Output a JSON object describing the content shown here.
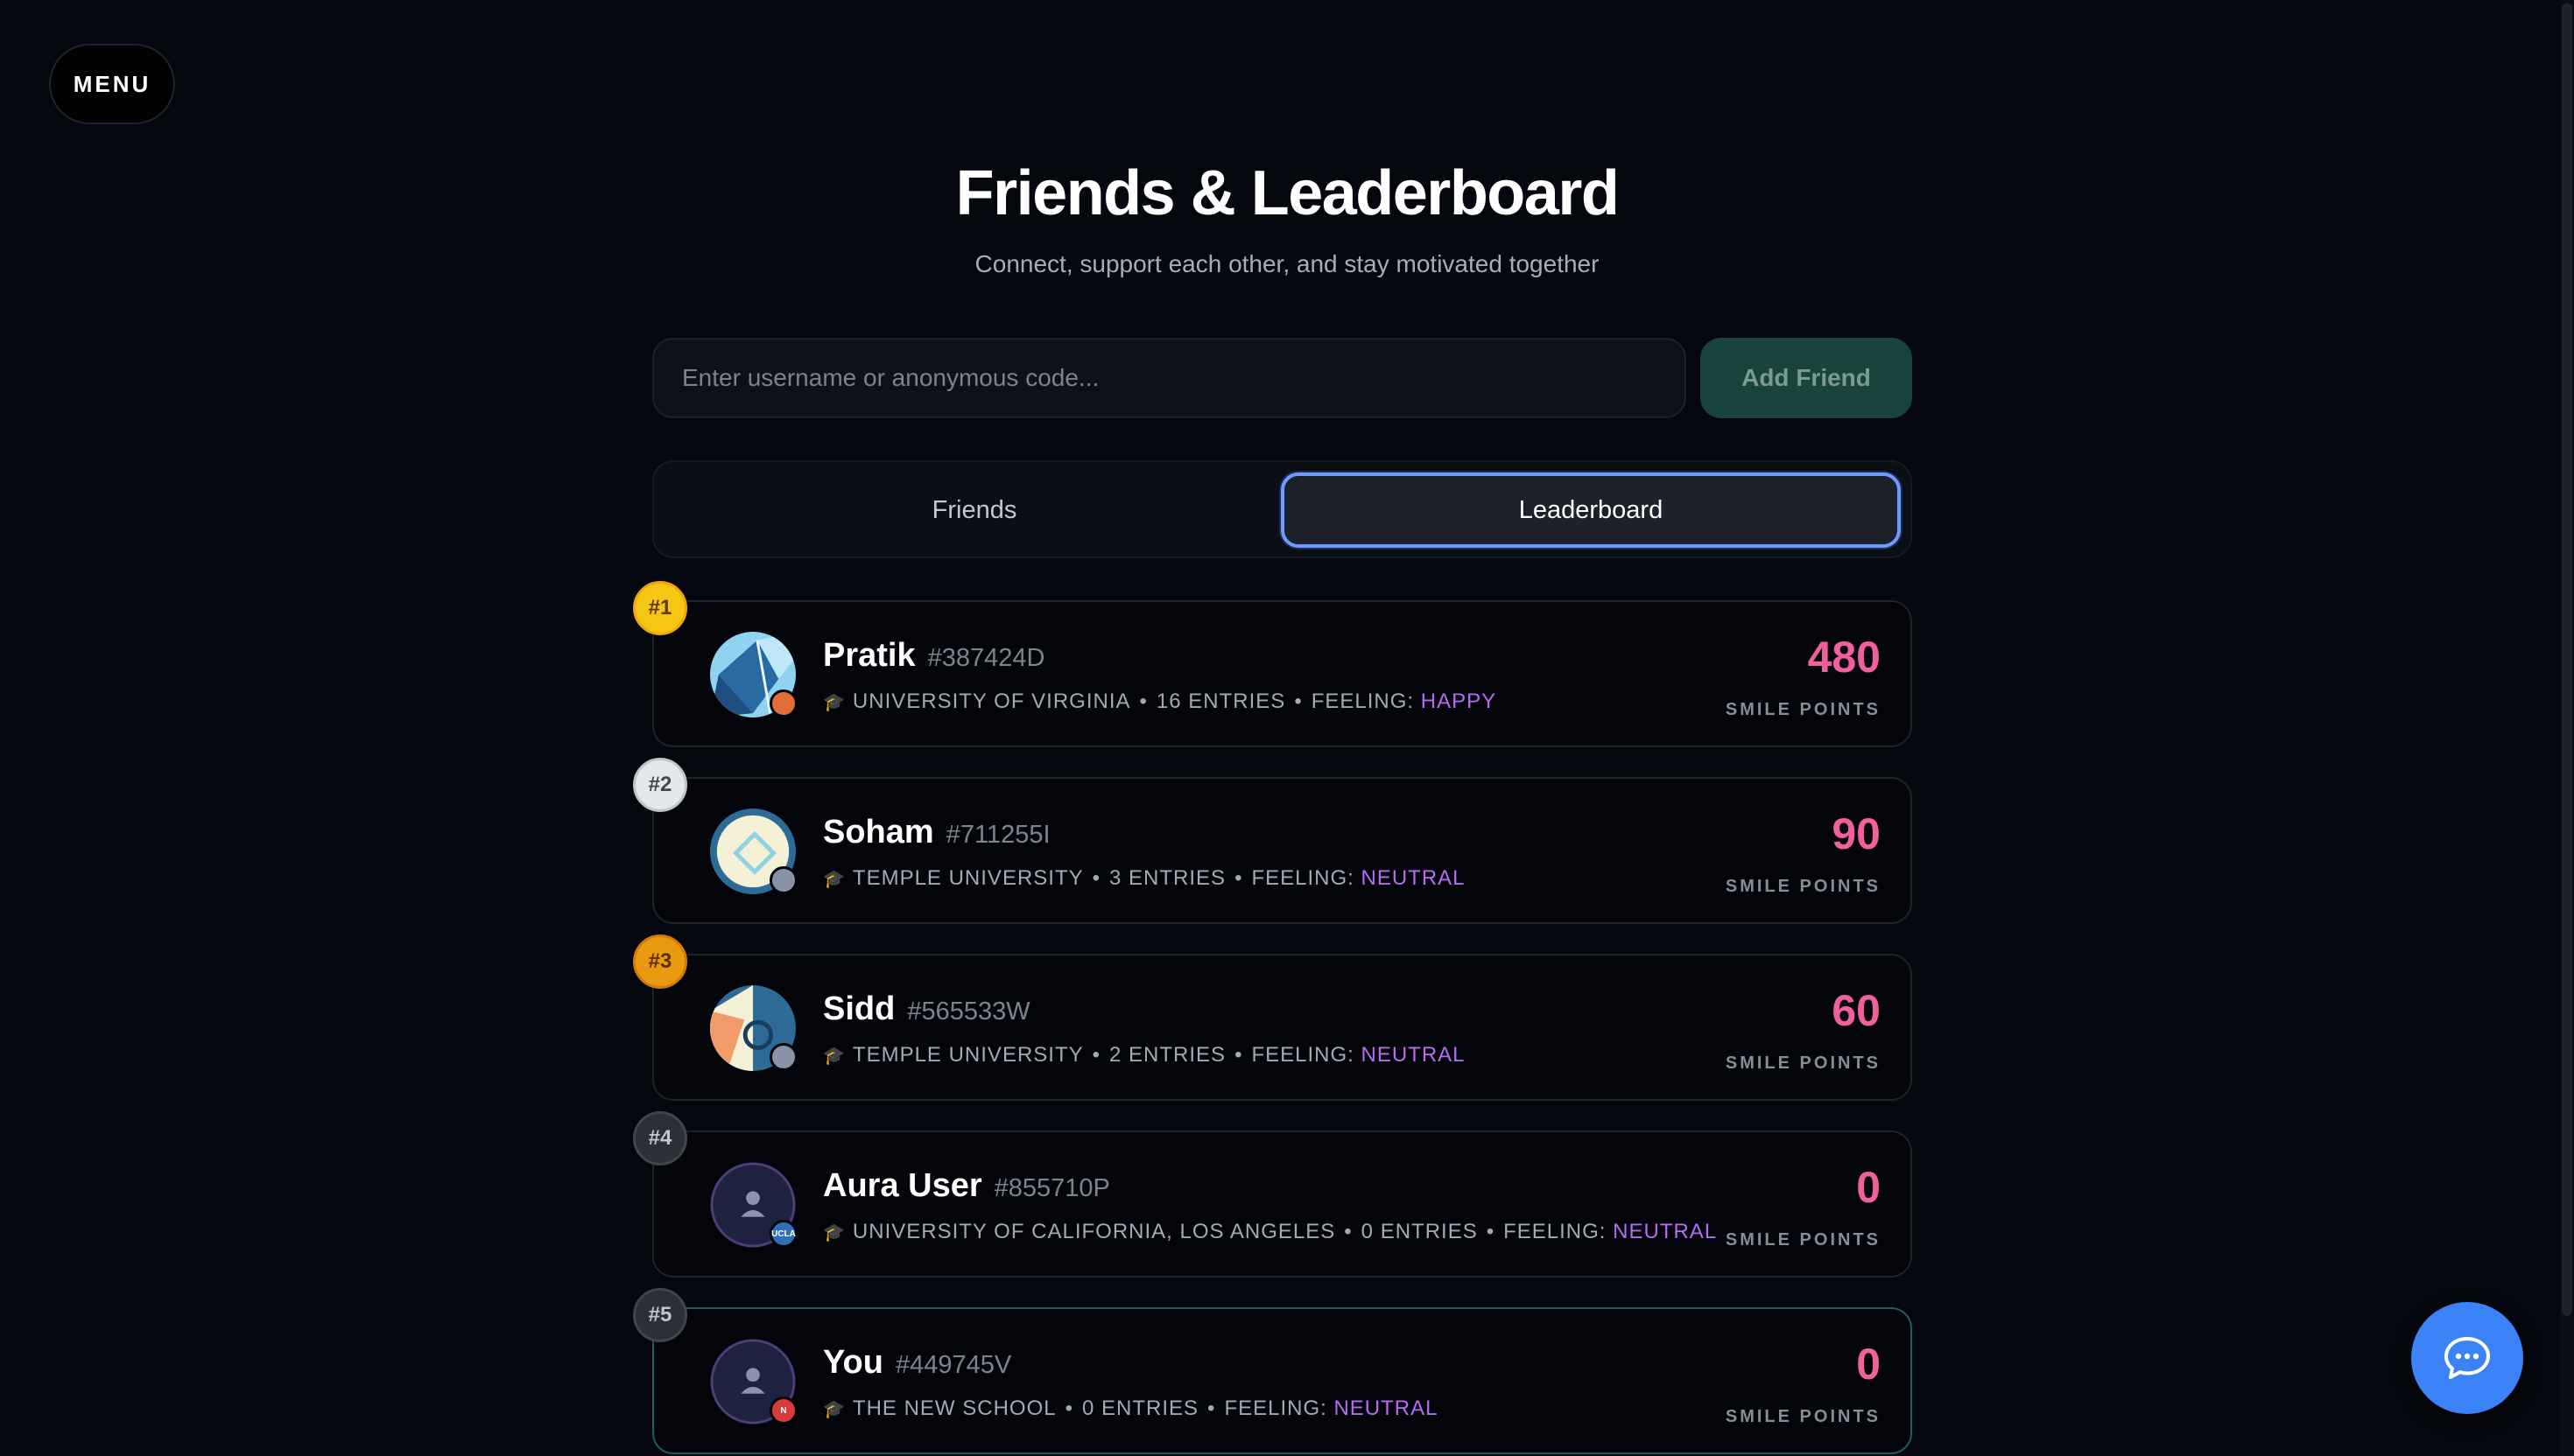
{
  "menu": {
    "label": "MENU"
  },
  "header": {
    "title": "Friends & Leaderboard",
    "subtitle": "Connect, support each other, and stay motivated together"
  },
  "search": {
    "placeholder": "Enter username or anonymous code...",
    "value": "",
    "add_label": "Add Friend"
  },
  "tabs": [
    {
      "label": "Friends",
      "active": false
    },
    {
      "label": "Leaderboard",
      "active": true
    }
  ],
  "colors": {
    "accent": "#3b82f6",
    "points": "#f0609a",
    "feeling": "#b46cf0",
    "gold": "#f7c514",
    "silver": "#e5e7eb",
    "bronze": "#ea9a10"
  },
  "leaderboard": [
    {
      "rank": "#1",
      "name": "Pratik",
      "code": "#387424D",
      "university": "UNIVERSITY OF VIRGINIA",
      "entries": "16 ENTRIES",
      "feeling_label": "FEELING:",
      "feeling": "HAPPY",
      "points": "480",
      "points_label": "SMILE POINTS",
      "avatar_icon": "geometric-avatar-icon",
      "badge_color": "#e26b3a"
    },
    {
      "rank": "#2",
      "name": "Soham",
      "code": "#711255I",
      "university": "TEMPLE UNIVERSITY",
      "entries": "3 ENTRIES",
      "feeling_label": "FEELING:",
      "feeling": "NEUTRAL",
      "points": "90",
      "points_label": "SMILE POINTS",
      "avatar_icon": "geometric-avatar-icon",
      "badge_color": "#8a93a6"
    },
    {
      "rank": "#3",
      "name": "Sidd",
      "code": "#565533W",
      "university": "TEMPLE UNIVERSITY",
      "entries": "2 ENTRIES",
      "feeling_label": "FEELING:",
      "feeling": "NEUTRAL",
      "points": "60",
      "points_label": "SMILE POINTS",
      "avatar_icon": "geometric-avatar-icon",
      "badge_color": "#8a93a6"
    },
    {
      "rank": "#4",
      "name": "Aura User",
      "code": "#855710P",
      "university": "UNIVERSITY OF CALIFORNIA, LOS ANGELES",
      "entries": "0 ENTRIES",
      "feeling_label": "FEELING:",
      "feeling": "NEUTRAL",
      "points": "0",
      "points_label": "SMILE POINTS",
      "avatar_icon": "default-user-avatar-icon",
      "badge_text": "UCLA",
      "badge_color": "#2f6fb5"
    },
    {
      "rank": "#5",
      "name": "You",
      "code": "#449745V",
      "university": "THE NEW SCHOOL",
      "entries": "0 ENTRIES",
      "feeling_label": "FEELING:",
      "feeling": "NEUTRAL",
      "points": "0",
      "points_label": "SMILE POINTS",
      "avatar_icon": "default-user-avatar-icon",
      "badge_text": "N",
      "badge_color": "#d93a3a"
    }
  ],
  "chat": {
    "icon": "chat-bubble-icon"
  }
}
